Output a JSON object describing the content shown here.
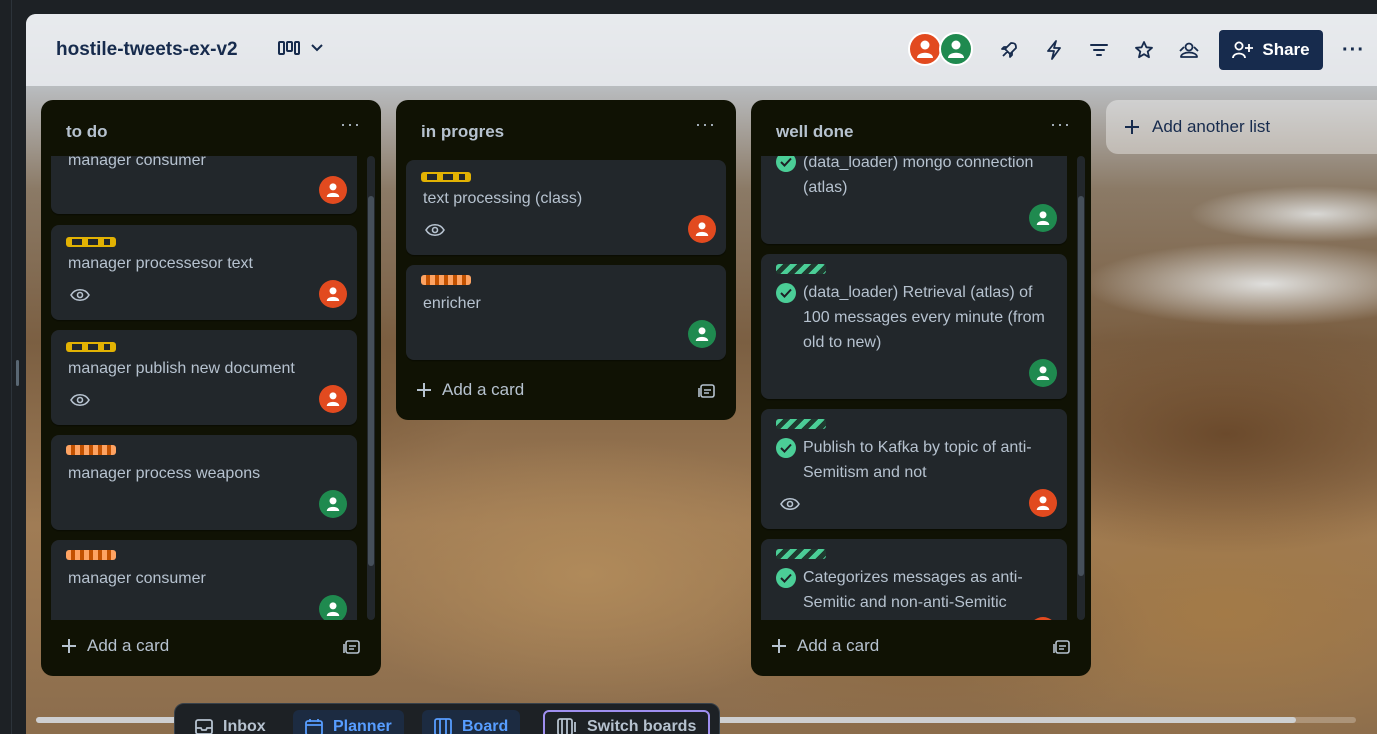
{
  "board": {
    "title": "hostile-tweets-ex-v2",
    "share_label": "Share",
    "add_list_label": "Add another list"
  },
  "lists": [
    {
      "title": "to do",
      "add_card_label": "Add a card",
      "cards": [
        {
          "title": "manager consumer",
          "labels": [],
          "has_watch": false,
          "avatar": "red"
        },
        {
          "title": "manager processesor text",
          "labels": [
            "yellow"
          ],
          "has_watch": true,
          "avatar": "red"
        },
        {
          "title": "manager publish new document",
          "labels": [
            "yellow"
          ],
          "has_watch": true,
          "avatar": "red"
        },
        {
          "title": "manager process weapons",
          "labels": [
            "orange"
          ],
          "has_watch": false,
          "avatar": "green"
        },
        {
          "title": "manager consumer",
          "labels": [
            "orange"
          ],
          "has_watch": false,
          "avatar": "green"
        }
      ]
    },
    {
      "title": "in progres",
      "add_card_label": "Add a card",
      "cards": [
        {
          "title": "text processing (class)",
          "labels": [
            "yellow"
          ],
          "has_watch": true,
          "avatar": "red"
        },
        {
          "title": "enricher",
          "labels": [
            "orange"
          ],
          "has_watch": false,
          "avatar": "green"
        }
      ]
    },
    {
      "title": "well done",
      "add_card_label": "Add a card",
      "cards": [
        {
          "title": "(data_loader) mongo connection (atlas)",
          "labels": [],
          "complete": true,
          "has_watch": false,
          "avatar": "green"
        },
        {
          "title": "(data_loader) Retrieval (atlas) of 100 messages every minute (from old to new)",
          "labels": [
            "green"
          ],
          "complete": true,
          "has_watch": false,
          "avatar": "green"
        },
        {
          "title": "Publish to Kafka by topic of anti-Semitism and not",
          "labels": [
            "green"
          ],
          "complete": true,
          "has_watch": true,
          "avatar": "red"
        },
        {
          "title": "Categorizes messages as anti-Semitic and non-anti-Semitic",
          "labels": [
            "green"
          ],
          "complete": true,
          "has_watch": false,
          "avatar": "red"
        }
      ]
    }
  ],
  "bottom_nav": {
    "inbox": "Inbox",
    "planner": "Planner",
    "board": "Board",
    "switch_boards": "Switch boards"
  },
  "colors": {
    "header_text": "#172b4d",
    "list_bg": "#101204",
    "card_bg": "#22272b",
    "avatar_red": "#e24a1f",
    "avatar_green": "#1f8a4f",
    "label_yellow": "#e2b203",
    "label_orange": "#fea362",
    "label_green": "#4bce97"
  }
}
